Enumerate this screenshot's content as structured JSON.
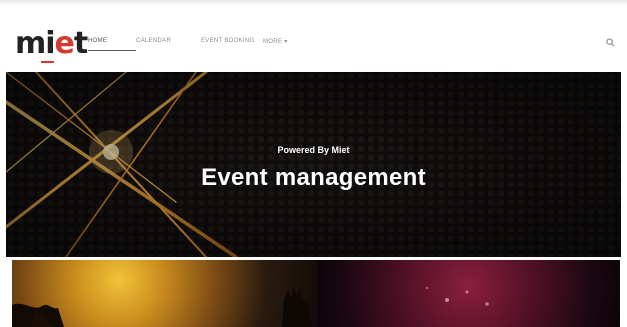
{
  "header": {
    "logo_main": "mi",
    "logo_accent": "e",
    "logo_tail": "t",
    "nav": [
      {
        "label": "Home"
      },
      {
        "label": "Calendar"
      },
      {
        "label": "Event Booking"
      },
      {
        "label": "More"
      }
    ],
    "icons": {
      "search": "search-icon",
      "dropdown": "chevron-down-icon"
    }
  },
  "hero": {
    "kicker": "Powered By Miet",
    "title": "Event management"
  },
  "colors": {
    "brand_red": "#d43a2f",
    "hero_bg": "#0f0d0c",
    "light_beam": "#f2a33b"
  }
}
